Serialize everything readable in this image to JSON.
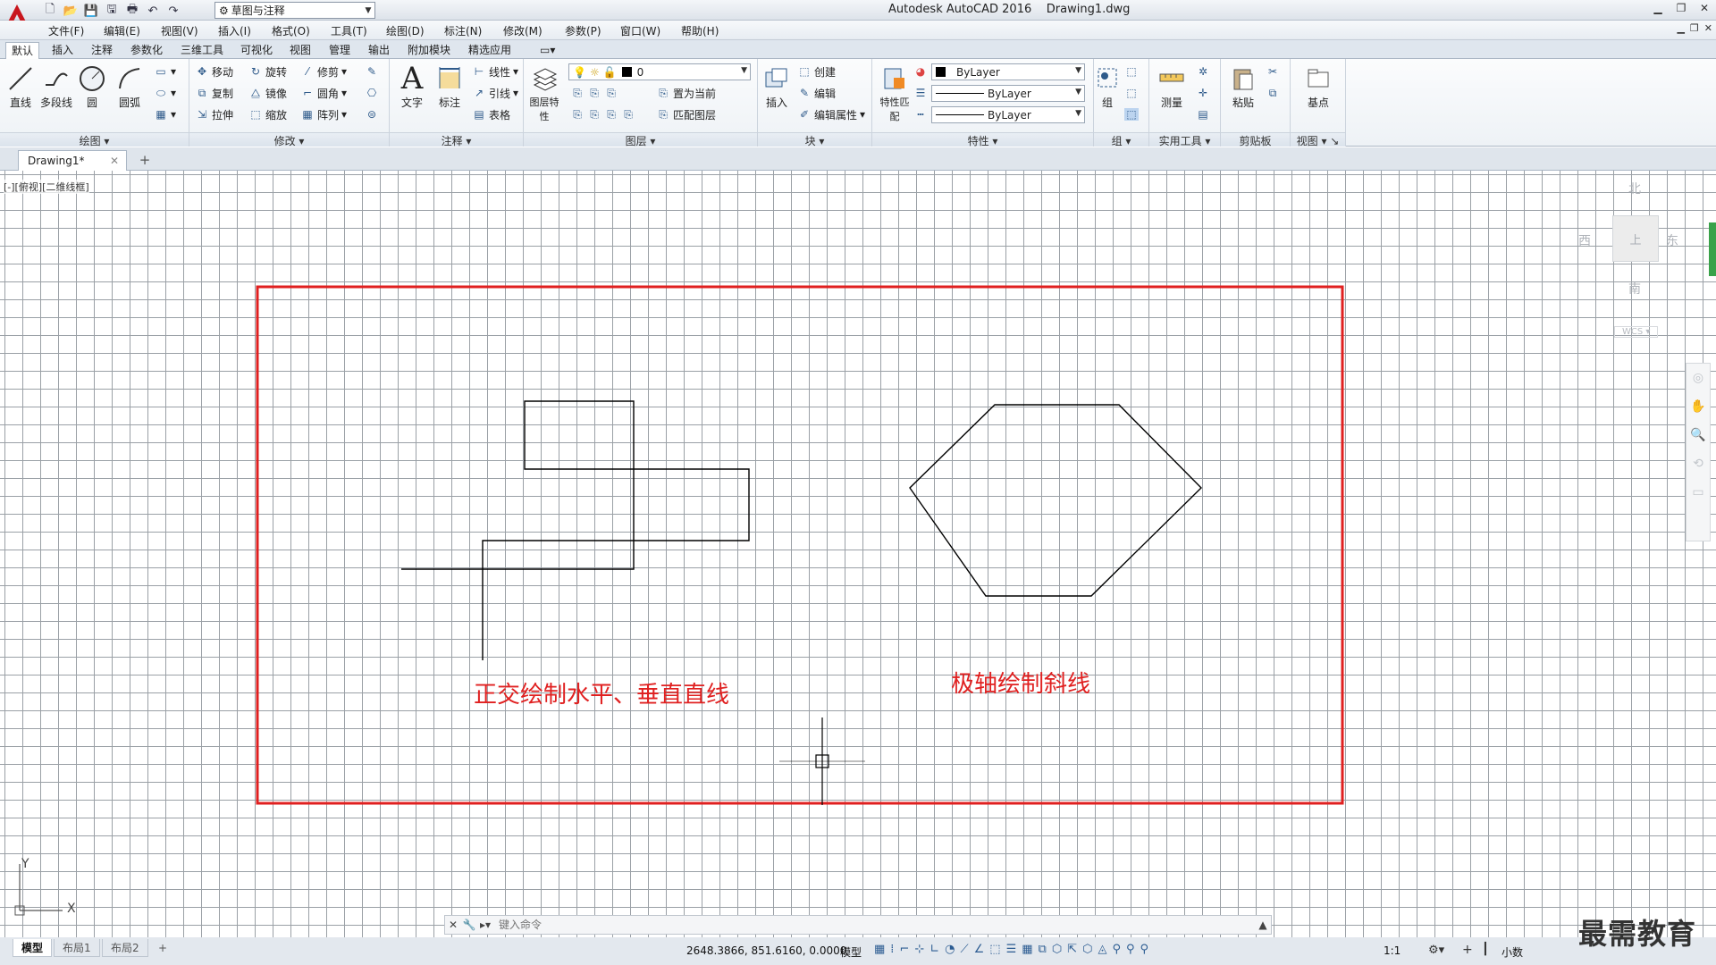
{
  "app": {
    "title": "Autodesk AutoCAD 2016",
    "document": "Drawing1.dwg",
    "workspace": "草图与注释"
  },
  "menus": [
    "文件(F)",
    "编辑(E)",
    "视图(V)",
    "插入(I)",
    "格式(O)",
    "工具(T)",
    "绘图(D)",
    "标注(N)",
    "修改(M)",
    "参数(P)",
    "窗口(W)",
    "帮助(H)"
  ],
  "ribbon_tabs": [
    "默认",
    "插入",
    "注释",
    "参数化",
    "三维工具",
    "可视化",
    "视图",
    "管理",
    "输出",
    "附加模块",
    "精选应用"
  ],
  "ribbon": {
    "draw": {
      "title": "绘图",
      "line": "直线",
      "polyline": "多段线",
      "circle": "圆",
      "arc": "圆弧"
    },
    "modify": {
      "title": "修改",
      "move": "移动",
      "rotate": "旋转",
      "trim": "修剪",
      "copy": "复制",
      "mirror": "镜像",
      "fillet": "圆角",
      "stretch": "拉伸",
      "scale": "缩放",
      "array": "阵列"
    },
    "annotation": {
      "title": "注释",
      "text": "文字",
      "dimension": "标注",
      "linear": "线性",
      "leader": "引线",
      "table": "表格"
    },
    "layers": {
      "title": "图层",
      "layer_props": "图层特性",
      "current_layer": "0",
      "set_current": "置为当前",
      "match_layer": "匹配图层"
    },
    "block": {
      "title": "块",
      "insert": "插入",
      "create": "创建",
      "edit": "编辑",
      "edit_attr": "编辑属性"
    },
    "properties": {
      "title": "特性",
      "match": "特性匹配",
      "color": "ByLayer",
      "linetype": "ByLayer",
      "lineweight": "ByLayer"
    },
    "groups": {
      "title": "组",
      "group": "组"
    },
    "utilities": {
      "title": "实用工具",
      "measure": "测量"
    },
    "clipboard": {
      "title": "剪贴板",
      "paste": "粘贴"
    },
    "view": {
      "title": "视图",
      "base": "基点"
    }
  },
  "file_tab": "Drawing1*",
  "viewport": {
    "label": "[-][俯视][二维线框]",
    "note_left": "正交绘制水平、垂直直线",
    "note_right": "极轴绘制斜线",
    "viewcube": {
      "north": "北",
      "south": "南",
      "west": "西",
      "east": "东",
      "top": "上",
      "wcs": "WCS"
    },
    "ucs_x": "X",
    "ucs_y": "Y"
  },
  "command": {
    "placeholder": "键入命令"
  },
  "layout_tabs": [
    "模型",
    "布局1",
    "布局2"
  ],
  "status": {
    "coords": "2648.3866, 851.6160, 0.0000",
    "model": "模型",
    "scale": "1:1",
    "units": "小数"
  },
  "watermark": "最需教育",
  "colors": {
    "annotation_red": "#e02020",
    "grid": "#9aa0a6",
    "geometry": "#000000"
  }
}
